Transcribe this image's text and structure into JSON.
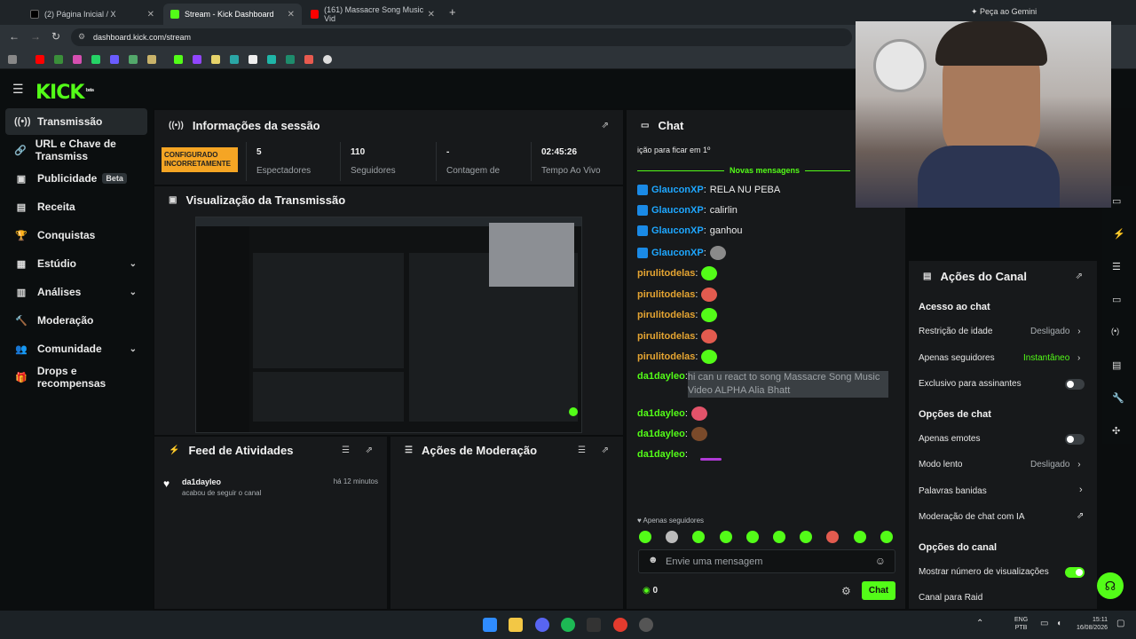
{
  "browser": {
    "tabs": [
      {
        "title": "(2) Página Inicial / X",
        "color": "#000000"
      },
      {
        "title": "Stream - Kick Dashboard",
        "color": "#53fc18"
      },
      {
        "title": "(161) Massacre Song Music Vid",
        "color": "#ff0000"
      }
    ],
    "gemini_label": "Peça ao Gemini",
    "url": "dashboard.kick.com/stream"
  },
  "header": {
    "logo": "KICK",
    "logo_tag": "beta"
  },
  "sidebar": {
    "items": [
      {
        "label": "Transmissão",
        "icon": "broadcast-icon"
      },
      {
        "label": "URL e Chave de Transmiss",
        "icon": "link-icon"
      },
      {
        "label": "Publicidade",
        "icon": "ads-icon",
        "badge": "Beta"
      },
      {
        "label": "Receita",
        "icon": "revenue-icon"
      },
      {
        "label": "Conquistas",
        "icon": "trophy-icon"
      },
      {
        "label": "Estúdio",
        "icon": "studio-icon"
      },
      {
        "label": "Análises",
        "icon": "analytics-icon"
      },
      {
        "label": "Moderação",
        "icon": "moderation-icon"
      },
      {
        "label": "Comunidade",
        "icon": "community-icon"
      },
      {
        "label": "Drops e recompensas",
        "icon": "drops-icon"
      }
    ]
  },
  "session": {
    "title": "Informações da sessão",
    "badge": "CONFIGURADO INCORRETAMENTE",
    "stats": [
      {
        "value": "5",
        "label": "Espectadores"
      },
      {
        "value": "110",
        "label": "Seguidores"
      },
      {
        "value": "-",
        "label": "Contagem de"
      },
      {
        "value": "02:45:26",
        "label": "Tempo Ao Vivo"
      }
    ]
  },
  "preview": {
    "title": "Visualização da Transmissão"
  },
  "feed": {
    "title": "Feed de Atividades",
    "items": [
      {
        "user": "da1dayleo",
        "text": "acabou de seguir o canal",
        "time": "há 12 minutos"
      }
    ]
  },
  "modactions": {
    "title": "Ações de Moderação"
  },
  "chat": {
    "title": "Chat",
    "pinned": "ição para ficar em 1º",
    "new_messages": "Novas mensagens",
    "messages": [
      {
        "user": "GlauconXP",
        "text": "RELA NU PEBA",
        "color": "#1ea7ff",
        "badge": true
      },
      {
        "user": "GlauconXP",
        "text": "calirlin",
        "color": "#1ea7ff",
        "badge": true
      },
      {
        "user": "GlauconXP",
        "text": "ganhou",
        "color": "#1ea7ff",
        "badge": true
      },
      {
        "user": "GlauconXP",
        "text": "",
        "color": "#1ea7ff",
        "badge": true
      },
      {
        "user": "pirulitodelas",
        "text": "",
        "color": "#e6a532"
      },
      {
        "user": "pirulitodelas",
        "text": "",
        "color": "#e6a532"
      },
      {
        "user": "pirulitodelas",
        "text": "",
        "color": "#e6a532"
      },
      {
        "user": "pirulitodelas",
        "text": "",
        "color": "#e6a532"
      },
      {
        "user": "pirulitodelas",
        "text": "",
        "color": "#e6a532"
      },
      {
        "user": "da1dayleo",
        "text": "hi can u react to song Massacre Song Music Video ALPHA Alia Bhatt",
        "color": "#53fc18"
      },
      {
        "user": "da1dayleo",
        "text": "",
        "color": "#53fc18"
      },
      {
        "user": "da1dayleo",
        "text": "",
        "color": "#53fc18"
      },
      {
        "user": "da1dayleo",
        "text": "",
        "color": "#53fc18"
      }
    ],
    "followers_only": "Apenas seguidores",
    "input_placeholder": "Envie uma mensagem",
    "points": "0",
    "send": "Chat"
  },
  "channel_actions": {
    "title": "Ações do Canal",
    "sections": {
      "chat_access": "Acesso ao chat",
      "chat_options": "Opções de chat",
      "channel_options": "Opções do canal"
    },
    "rows": {
      "age": {
        "label": "Restrição de idade",
        "value": "Desligado"
      },
      "followers": {
        "label": "Apenas seguidores",
        "value": "Instantâneo"
      },
      "subs": {
        "label": "Exclusivo para assinantes"
      },
      "emotes": {
        "label": "Apenas emotes"
      },
      "slow": {
        "label": "Modo lento",
        "value": "Desligado"
      },
      "banned": {
        "label": "Palavras banidas"
      },
      "ai": {
        "label": "Moderação de chat com IA"
      },
      "views": {
        "label": "Mostrar número de visualizações"
      },
      "raid": {
        "label": "Canal para Raid"
      }
    },
    "toggles": {
      "subs": false,
      "emotes": false,
      "views": true
    }
  },
  "taskbar": {
    "lang1": "ENG",
    "lang2": "PTB",
    "time": "15:11",
    "date": "16/08/2026"
  }
}
